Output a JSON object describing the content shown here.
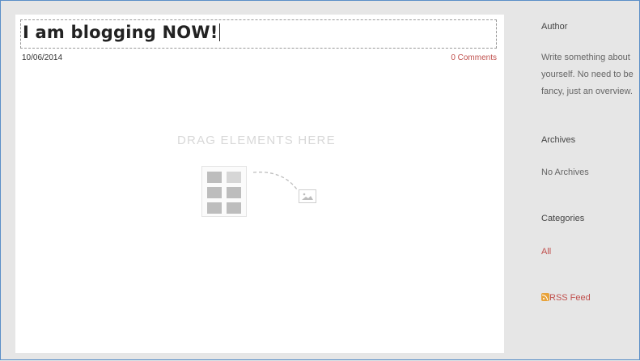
{
  "post": {
    "title": "I am blogging NOW!",
    "date": "10/06/2014",
    "comments": "0 Comments",
    "drop_zone_text": "DRAG ELEMENTS HERE"
  },
  "sidebar": {
    "author": {
      "heading": "Author",
      "text": "Write something about yourself. No need to be fancy, just an overview."
    },
    "archives": {
      "heading": "Archives",
      "text": "No Archives"
    },
    "categories": {
      "heading": "Categories",
      "items": [
        {
          "label": "All"
        }
      ]
    },
    "rss": {
      "label": "RSS Feed",
      "icon": "rss-icon"
    }
  },
  "colors": {
    "link": "#c0504d",
    "background": "#e6e6e6",
    "card": "#ffffff",
    "frame_border": "#5b8fc7"
  }
}
